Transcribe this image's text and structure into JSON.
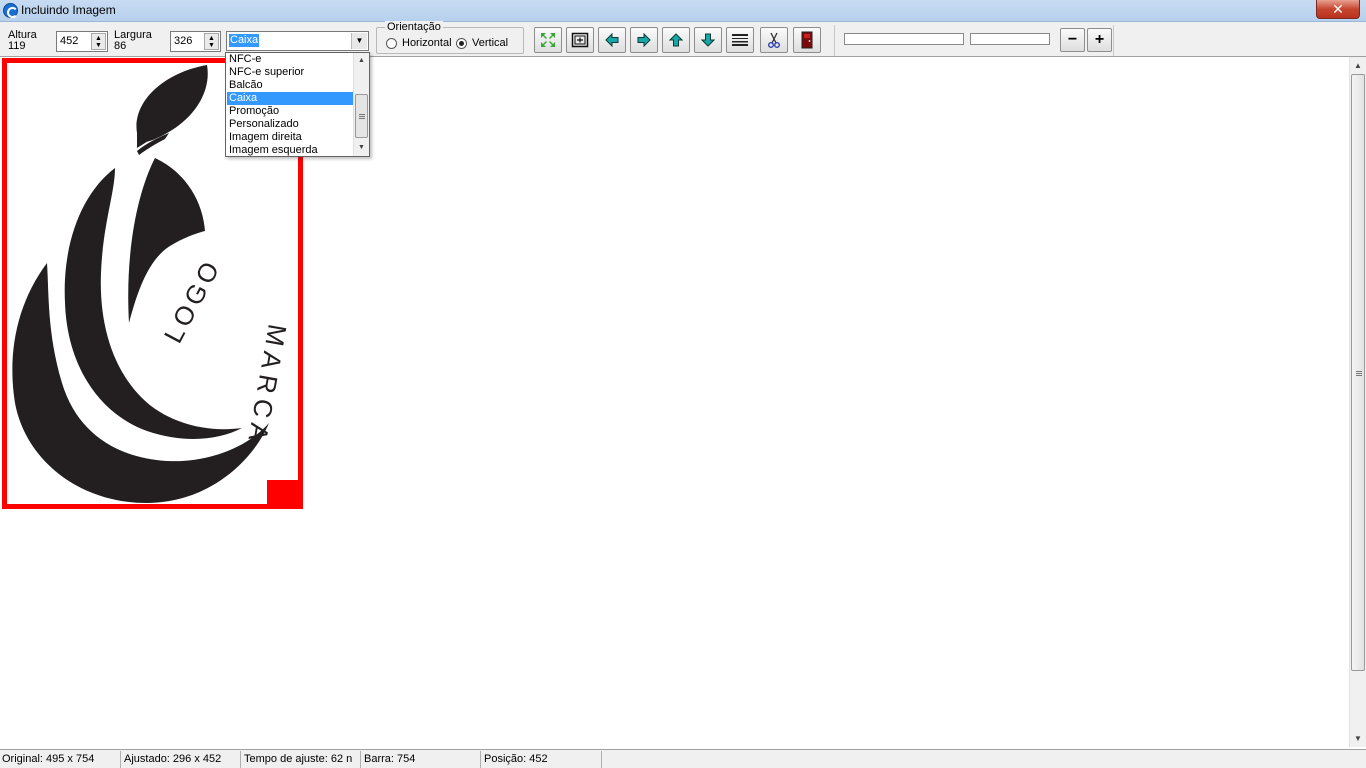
{
  "window": {
    "title": "Incluindo Imagem",
    "close_label": "✕"
  },
  "toolbar": {
    "altura_label": "Altura",
    "altura_sub": "119",
    "altura_value": "452",
    "largura_label": "Largura",
    "largura_sub": "86",
    "largura_value": "326",
    "layout_select": {
      "selected": "Caixa",
      "options": [
        "NFC-e",
        "NFC-e superior",
        "Balcão",
        "Caixa",
        "Promoção",
        "Personalizado",
        "Imagem direita",
        "Imagem esquerda"
      ]
    },
    "orientation": {
      "legend": "Orientação",
      "horizontal_label": "Horizontal",
      "vertical_label": "Vertical",
      "selected": "Vertical"
    },
    "buttons": [
      {
        "name": "fit-button",
        "icon": "expand-arrows-icon"
      },
      {
        "name": "center-button",
        "icon": "center-frame-icon"
      },
      {
        "name": "move-left-button",
        "icon": "arrow-left-icon"
      },
      {
        "name": "move-right-button",
        "icon": "arrow-right-icon"
      },
      {
        "name": "move-up-button",
        "icon": "arrow-up-icon"
      },
      {
        "name": "move-down-button",
        "icon": "arrow-down-icon"
      },
      {
        "name": "barcode-button",
        "icon": "barcode-icon"
      },
      {
        "name": "cut-button",
        "icon": "scissors-icon"
      },
      {
        "name": "exit-button",
        "icon": "door-exit-icon"
      }
    ],
    "zoom_out_label": "−",
    "zoom_in_label": "+"
  },
  "image": {
    "logo_text_1": "LOGO",
    "logo_text_2": "MARCA",
    "colors": {
      "frame": "#ff0000",
      "logo": "#231f20"
    }
  },
  "statusbar": {
    "original": "Original: 495 x 754",
    "ajustado": "Ajustado: 296 x 452",
    "tempo": "Tempo de ajuste: 62 n",
    "barra": "Barra: 754",
    "posicao": "Posição: 452"
  }
}
